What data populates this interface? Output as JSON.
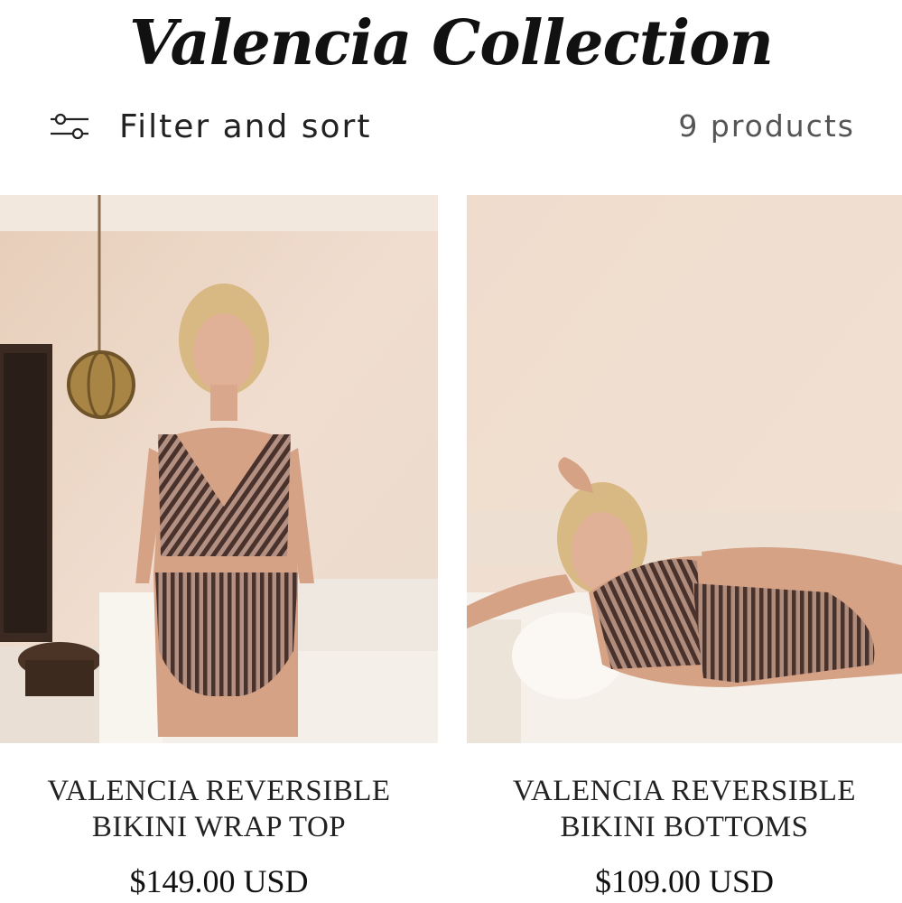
{
  "collection": {
    "title": "Valencia Collection"
  },
  "toolbar": {
    "filter_label": "Filter and sort",
    "filter_icon": "sliders-icon",
    "product_count": "9 products"
  },
  "products": [
    {
      "name": "VALENCIA REVERSIBLE\nBIKINI WRAP TOP",
      "price": "$149.00 USD",
      "image_icon": "product-photo-standing-model"
    },
    {
      "name": "VALENCIA REVERSIBLE\nBIKINI BOTTOMS",
      "price": "$109.00 USD",
      "image_icon": "product-photo-reclining-model"
    }
  ],
  "colors": {
    "wall": "#ecd8c8",
    "swimsuit": "#5a4038",
    "text": "#1c1c1c"
  }
}
